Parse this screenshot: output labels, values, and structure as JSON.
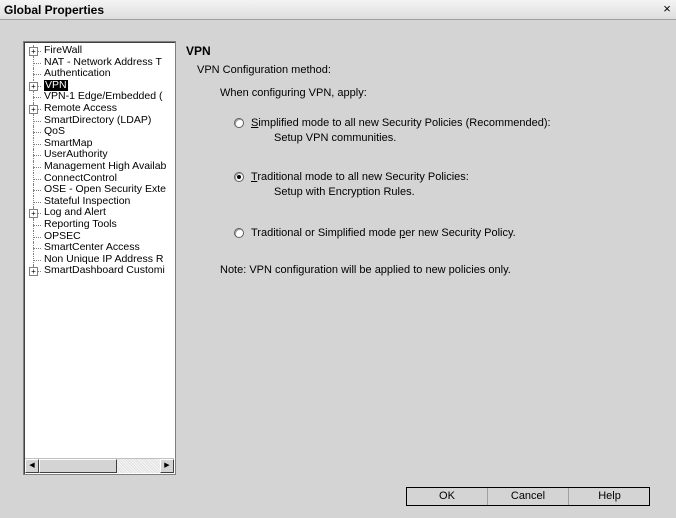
{
  "window": {
    "title": "Global Properties",
    "close_glyph": "×"
  },
  "tree": {
    "items": [
      {
        "label": "FireWall",
        "expandable": true
      },
      {
        "label": "NAT - Network Address T",
        "expandable": false
      },
      {
        "label": "Authentication",
        "expandable": false
      },
      {
        "label": "VPN",
        "expandable": true,
        "selected": true
      },
      {
        "label": "VPN-1 Edge/Embedded (",
        "expandable": false
      },
      {
        "label": "Remote Access",
        "expandable": true
      },
      {
        "label": "SmartDirectory (LDAP)",
        "expandable": false
      },
      {
        "label": "QoS",
        "expandable": false
      },
      {
        "label": "SmartMap",
        "expandable": false
      },
      {
        "label": "UserAuthority",
        "expandable": false
      },
      {
        "label": "Management High Availab",
        "expandable": false
      },
      {
        "label": "ConnectControl",
        "expandable": false
      },
      {
        "label": "OSE - Open Security Exte",
        "expandable": false
      },
      {
        "label": "Stateful Inspection",
        "expandable": false
      },
      {
        "label": "Log and Alert",
        "expandable": true
      },
      {
        "label": "Reporting Tools",
        "expandable": false
      },
      {
        "label": "OPSEC",
        "expandable": false
      },
      {
        "label": "SmartCenter Access",
        "expandable": false
      },
      {
        "label": "Non Unique IP Address R",
        "expandable": false
      },
      {
        "label": "SmartDashboard Customi",
        "expandable": true
      }
    ],
    "scroll_left_glyph": "◀",
    "scroll_right_glyph": "▶"
  },
  "vpn": {
    "title": "VPN",
    "method_label": "VPN Configuration method:",
    "apply_label": "When configuring VPN, apply:",
    "options": [
      {
        "mnemonic": "S",
        "text_rest": "implified mode to all new Security Policies (Recommended):",
        "sub": "Setup VPN communities.",
        "checked": false
      },
      {
        "mnemonic": "T",
        "text_rest": "raditional mode to all new Security Policies:",
        "sub": "Setup with Encryption Rules.",
        "checked": true
      },
      {
        "text_before": "Traditional or Simplified mode ",
        "mnemonic": "p",
        "text_rest": "er new Security Policy.",
        "checked": false
      }
    ],
    "note": "Note: VPN configuration will be applied to new policies only."
  },
  "buttons": {
    "ok": "OK",
    "cancel": "Cancel",
    "help": "Help"
  },
  "colors": {
    "dialog_bg": "#d4d4d4",
    "selection_bg": "#000000",
    "selection_fg": "#ffffff"
  }
}
